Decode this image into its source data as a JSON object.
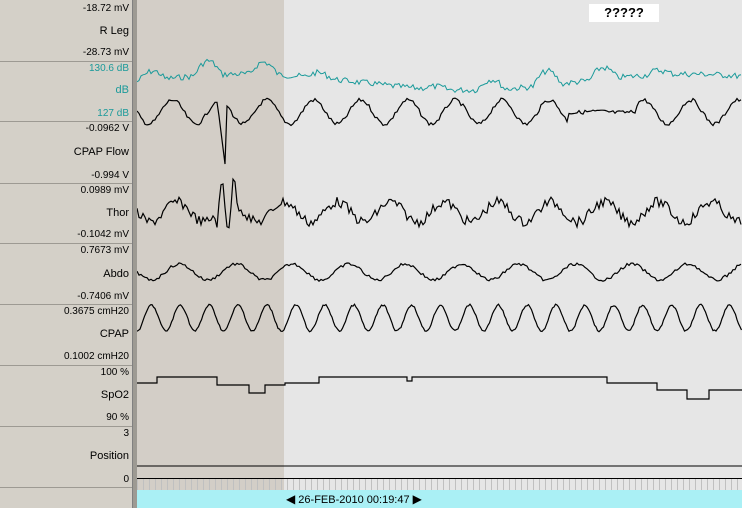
{
  "channels": [
    {
      "id": "rleg",
      "name": "R Leg",
      "top_value": "-18.72 mV",
      "bottom_value": "-28.73 mV",
      "color": "#000000"
    },
    {
      "id": "db",
      "name": "dB",
      "top_value": "130.6 dB",
      "bottom_value": "127 dB",
      "color": "#1a9a9a"
    },
    {
      "id": "cpapflow",
      "name": "CPAP Flow",
      "top_value": "-0.0962 V",
      "bottom_value": "-0.994 V",
      "color": "#000000"
    },
    {
      "id": "thor",
      "name": "Thor",
      "top_value": "0.0989 mV",
      "bottom_value": "-0.1042 mV",
      "color": "#000000"
    },
    {
      "id": "abdo",
      "name": "Abdo",
      "top_value": "0.7673 mV",
      "bottom_value": "-0.7406 mV",
      "color": "#000000"
    },
    {
      "id": "cpap",
      "name": "CPAP",
      "top_value": "0.3675 cmH20",
      "bottom_value": "0.1002 cmH20",
      "color": "#000000"
    },
    {
      "id": "spo2",
      "name": "SpO2",
      "top_value": "100 %",
      "bottom_value": "90 %",
      "color": "#000000"
    },
    {
      "id": "position",
      "name": "Position",
      "top_value": "3",
      "bottom_value": "0",
      "color": "#000000"
    }
  ],
  "annotation": "?????",
  "timeline": {
    "timestamp": "26-FEB-2010 00:19:47",
    "prev_icon": "triangle-left-icon",
    "next_icon": "triangle-right-icon"
  },
  "colors": {
    "trace": "#000000",
    "sound_trace": "#1a9a9a",
    "selection_shade": "#d3cec7",
    "timebar": "#aaf0f5"
  }
}
